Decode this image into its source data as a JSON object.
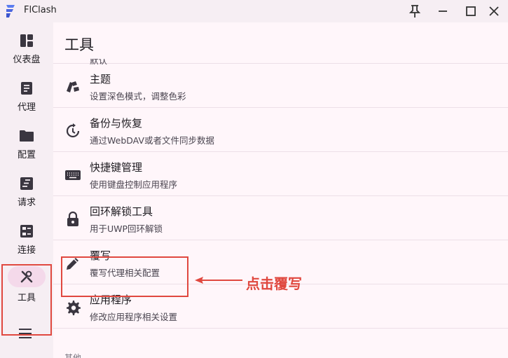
{
  "window": {
    "title": "FlClash",
    "controls": [
      "pin-icon",
      "minimize-icon",
      "maximize-icon",
      "close-icon"
    ]
  },
  "sidebar": {
    "items": [
      {
        "label": "仪表盘",
        "icon": "dashboard-icon"
      },
      {
        "label": "代理",
        "icon": "proxy-list-icon"
      },
      {
        "label": "配置",
        "icon": "folder-icon"
      },
      {
        "label": "请求",
        "icon": "requests-icon"
      },
      {
        "label": "连接",
        "icon": "connections-icon"
      },
      {
        "label": "工具",
        "icon": "tools-icon",
        "selected": true
      }
    ],
    "menu_icon": "hamburger-menu-icon"
  },
  "main": {
    "title": "工具",
    "partial_top_subtitle": "默认",
    "rows": [
      {
        "title": "主题",
        "subtitle": "设置深色模式，调整色彩",
        "icon": "palette-icon"
      },
      {
        "title": "备份与恢复",
        "subtitle": "通过WebDAV或者文件同步数据",
        "icon": "backup-restore-icon"
      },
      {
        "title": "快捷键管理",
        "subtitle": "使用键盘控制应用程序",
        "icon": "keyboard-icon"
      },
      {
        "title": "回环解锁工具",
        "subtitle": "用于UWP回环解锁",
        "icon": "lock-icon"
      },
      {
        "title": "覆写",
        "subtitle": "覆写代理相关配置",
        "icon": "pencil-icon"
      },
      {
        "title": "应用程序",
        "subtitle": "修改应用程序相关设置",
        "icon": "gear-icon"
      }
    ],
    "section_peek": "其他"
  },
  "annotation": {
    "text": "点击覆写",
    "color": "#e0483f"
  },
  "colors": {
    "background": "#fff6fa",
    "sidebar": "#f6eef3",
    "selected_pill": "#f4d9ea",
    "annotation_red": "#e0483f"
  }
}
